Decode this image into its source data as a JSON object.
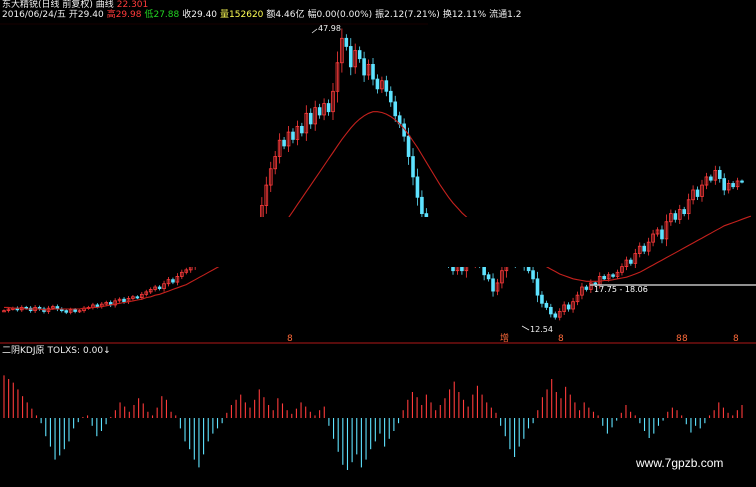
{
  "header": {
    "line1_title": "东大精锐(日线 前复权) 曲线",
    "line1_value": "22.301",
    "line2": {
      "date": "2016/06/24/五",
      "open_label": "开",
      "open": "29.40",
      "high_label": "高",
      "high": "29.98",
      "low_label": "低",
      "low": "27.88",
      "close_label": "收",
      "close": "29.40",
      "volume_label": "量",
      "volume": "152620",
      "amount_label": "额",
      "amount": "4.46亿",
      "change_label": "幅",
      "change": "0.00(0.00%)",
      "amplitude_label": "振",
      "amplitude": "2.12(7.21%)",
      "turnover_label": "换",
      "turnover": "12.11%",
      "float_label": "流通",
      "float": "1.2"
    }
  },
  "indicator": {
    "label": "二阴KDJ原",
    "value_label": "TOLXS:",
    "value": "0.00",
    "arrow": "↓"
  },
  "price_range_label": "17.75 - 18.06",
  "markers": [
    "8",
    "增",
    "8",
    "8",
    "8",
    "8"
  ],
  "watermark": "www.7gpzb.com",
  "colors": {
    "up": "#ff3b3b",
    "down": "#5fe3ff",
    "ma": "#c4211d",
    "bg": "#000000"
  },
  "chart_data": [
    {
      "type": "candlestick",
      "title": "",
      "annotations": [
        {
          "label": "47.98",
          "kind": "high"
        },
        {
          "label": "12.54",
          "kind": "low"
        }
      ],
      "price_values": [
        13.6,
        13.8,
        13.9,
        13.7,
        14.0,
        13.9,
        13.6,
        14.0,
        13.8,
        13.5,
        13.9,
        14.1,
        13.8,
        13.6,
        13.4,
        13.7,
        13.5,
        13.6,
        13.9,
        14.0,
        14.3,
        14.1,
        14.4,
        14.6,
        14.3,
        14.8,
        15.0,
        14.7,
        15.1,
        15.3,
        15.2,
        15.6,
        15.9,
        16.2,
        16.5,
        16.3,
        16.9,
        17.4,
        17.1,
        17.8,
        18.3,
        18.6,
        19.2,
        20.5,
        21.4,
        20.7,
        21.6,
        20.9,
        20.2,
        21.0,
        20.4,
        19.7,
        20.5,
        21.2,
        21.9,
        22.2,
        22.6,
        24.0,
        26.5,
        29.0,
        31.0,
        32.5,
        34.5,
        33.8,
        35.5,
        34.6,
        36.2,
        35.4,
        37.8,
        36.5,
        38.5,
        37.6,
        39.0,
        38.0,
        40.5,
        44.0,
        47.0,
        46.0,
        43.5,
        45.5,
        44.5,
        42.5,
        43.8,
        42.0,
        40.8,
        41.8,
        40.5,
        39.2,
        37.5,
        36.5,
        35.0,
        32.5,
        30.0,
        27.5,
        25.5,
        24.0,
        22.5,
        21.5,
        22.0,
        21.0,
        19.5,
        18.5,
        19.5,
        18.5,
        20.5,
        19.5,
        21.0,
        19.5,
        18.0,
        17.5,
        16.0,
        17.0,
        18.5,
        20.5,
        21.0,
        19.5,
        20.0,
        19.0,
        18.5,
        17.5,
        15.5,
        14.5,
        14.0,
        13.2,
        12.8,
        13.5,
        14.3,
        13.8,
        14.7,
        15.5,
        16.5,
        16.2,
        17.0,
        16.8,
        17.8,
        17.5,
        18.0,
        17.8,
        18.3,
        19.0,
        19.8,
        19.4,
        20.6,
        21.5,
        20.9,
        22.0,
        23.0,
        23.5,
        22.4,
        24.5,
        25.5,
        24.8,
        26.0,
        25.5,
        27.2,
        28.4,
        27.6,
        29.0,
        30.0,
        29.6,
        30.8,
        29.8,
        28.4,
        29.2,
        28.8,
        29.5,
        29.4
      ],
      "ma_values": [
        14.0,
        14.0,
        13.9,
        13.9,
        13.9,
        13.8,
        13.8,
        13.8,
        13.8,
        13.7,
        13.7,
        13.8,
        13.8,
        13.8,
        13.8,
        13.8,
        13.8,
        13.8,
        13.9,
        13.9,
        14.0,
        14.0,
        14.1,
        14.2,
        14.3,
        14.4,
        14.5,
        14.6,
        14.7,
        14.8,
        14.9,
        15.0,
        15.2,
        15.3,
        15.5,
        15.6,
        15.8,
        16.0,
        16.2,
        16.4,
        16.6,
        16.8,
        17.1,
        17.4,
        17.7,
        18.0,
        18.3,
        18.6,
        18.9,
        19.2,
        19.4,
        19.6,
        19.8,
        20.0,
        20.2,
        20.4,
        20.6,
        20.9,
        21.3,
        21.8,
        22.3,
        22.9,
        23.6,
        24.3,
        25.0,
        25.8,
        26.6,
        27.4,
        28.2,
        29.0,
        29.8,
        30.6,
        31.4,
        32.2,
        33.0,
        33.8,
        34.6,
        35.3,
        36.0,
        36.6,
        37.1,
        37.5,
        37.8,
        38.0,
        38.0,
        37.9,
        37.7,
        37.4,
        37.0,
        36.5,
        35.9,
        35.2,
        34.4,
        33.6,
        32.7,
        31.8,
        30.9,
        30.0,
        29.1,
        28.3,
        27.5,
        26.8,
        26.2,
        25.6,
        25.1,
        24.6,
        24.2,
        23.8,
        23.4,
        23.0,
        22.6,
        22.3,
        22.0,
        21.7,
        21.4,
        21.1,
        20.8,
        20.5,
        20.2,
        19.9,
        19.6,
        19.3,
        19.0,
        18.7,
        18.4,
        18.1,
        17.9,
        17.7,
        17.5,
        17.4,
        17.3,
        17.2,
        17.2,
        17.2,
        17.2,
        17.3,
        17.3,
        17.4,
        17.5,
        17.6,
        17.7,
        17.9,
        18.1,
        18.3,
        18.6,
        18.9,
        19.2,
        19.5,
        19.8,
        20.1,
        20.4,
        20.7,
        21.0,
        21.3,
        21.6,
        21.9,
        22.2,
        22.5,
        22.8,
        23.1,
        23.4,
        23.7,
        24.0,
        24.2,
        24.4,
        24.6,
        24.8,
        25.0,
        25.2
      ],
      "ylim": [
        10.0,
        49.0
      ]
    },
    {
      "type": "bar",
      "title": "二阴KDJ原",
      "series": [
        {
          "name": "TOLXS",
          "values": [
            0.82,
            0.75,
            0.68,
            0.55,
            0.42,
            0.3,
            0.18,
            0.05,
            -0.1,
            -0.35,
            -0.55,
            -0.8,
            -0.72,
            -0.6,
            -0.45,
            -0.2,
            -0.08,
            0.02,
            0.05,
            -0.15,
            -0.35,
            -0.25,
            -0.12,
            0.02,
            0.15,
            0.3,
            0.22,
            0.12,
            0.25,
            0.38,
            0.28,
            0.12,
            0.05,
            0.2,
            0.42,
            0.35,
            0.12,
            0.05,
            -0.2,
            -0.45,
            -0.6,
            -0.8,
            -0.95,
            -0.7,
            -0.45,
            -0.3,
            -0.2,
            -0.1,
            0.1,
            0.25,
            0.35,
            0.45,
            0.3,
            0.2,
            0.35,
            0.55,
            0.4,
            0.25,
            0.15,
            0.38,
            0.28,
            0.15,
            0.08,
            0.18,
            0.3,
            0.22,
            0.12,
            0.05,
            0.15,
            0.22,
            -0.15,
            -0.4,
            -0.65,
            -0.9,
            -1.0,
            -0.85,
            -0.7,
            -0.95,
            -0.8,
            -0.6,
            -0.45,
            -0.3,
            -0.55,
            -0.4,
            -0.25,
            -0.1,
            0.15,
            0.35,
            0.5,
            0.4,
            0.25,
            0.45,
            0.3,
            0.15,
            0.25,
            0.38,
            0.55,
            0.7,
            0.5,
            0.35,
            0.22,
            0.45,
            0.62,
            0.45,
            0.3,
            0.2,
            0.1,
            -0.15,
            -0.35,
            -0.6,
            -0.75,
            -0.55,
            -0.4,
            -0.2,
            -0.1,
            0.15,
            0.4,
            0.55,
            0.75,
            0.5,
            0.38,
            0.6,
            0.45,
            0.3,
            0.15,
            0.3,
            0.2,
            0.12,
            0.05,
            -0.15,
            -0.3,
            -0.18,
            -0.05,
            0.1,
            0.25,
            0.12,
            0.05,
            -0.1,
            -0.25,
            -0.45,
            -0.3,
            -0.15,
            -0.05,
            0.12,
            0.2,
            0.15,
            0.05,
            -0.12,
            -0.28,
            -0.15,
            -0.2,
            -0.1,
            0.05,
            0.15,
            0.3,
            0.2,
            0.1,
            0.05,
            0.15,
            0.25
          ]
        }
      ],
      "ylim": [
        -1.0,
        1.0
      ]
    }
  ]
}
